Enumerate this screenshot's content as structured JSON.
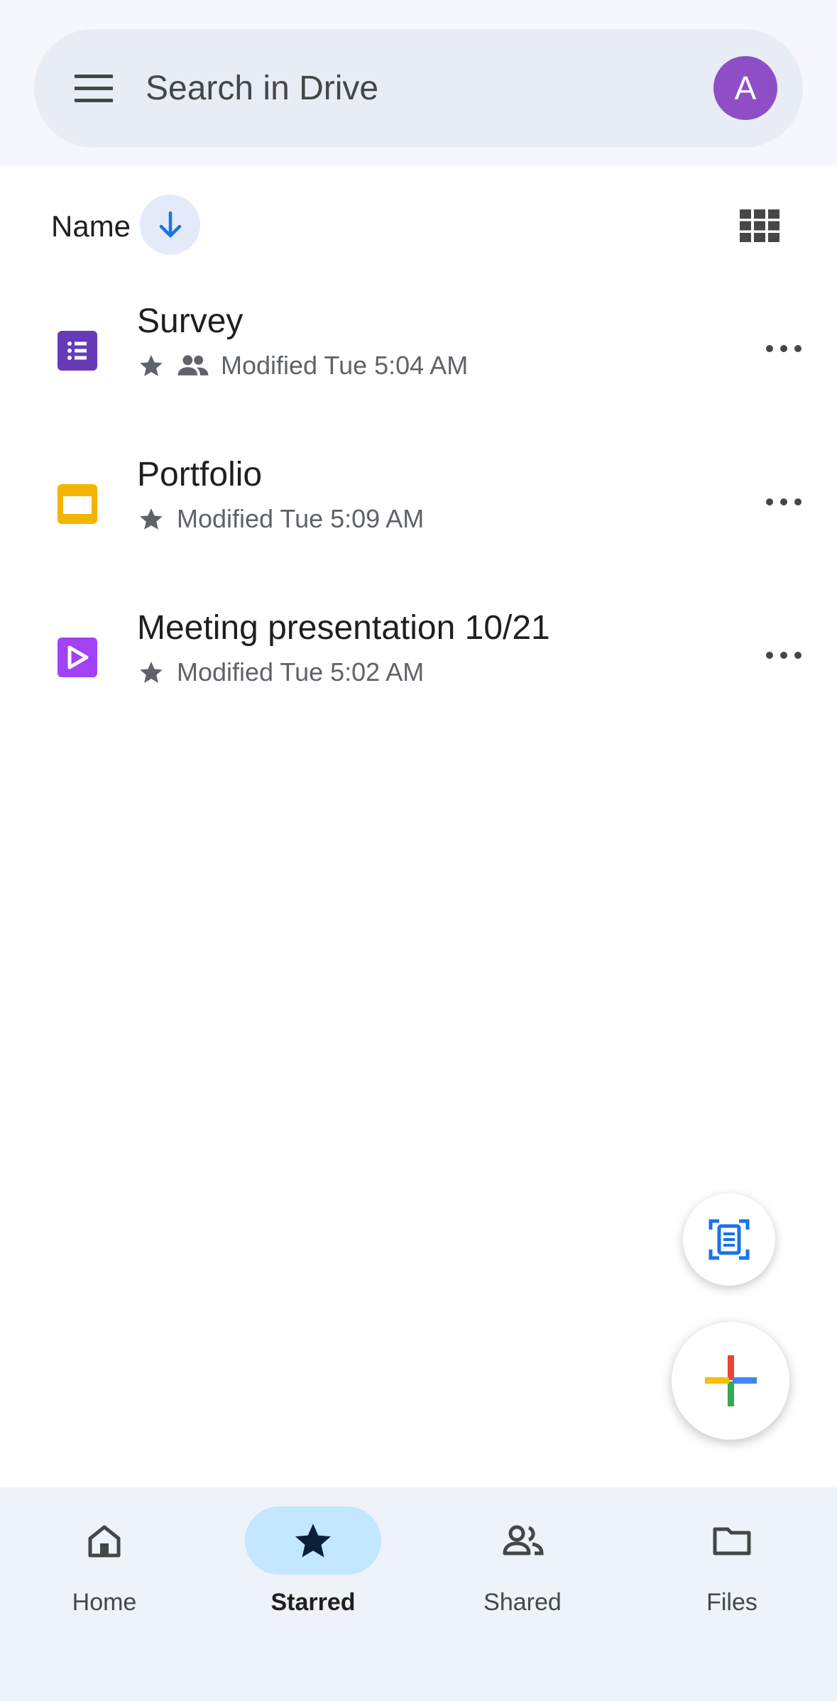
{
  "search": {
    "placeholder": "Search in Drive",
    "avatar_letter": "A",
    "avatar_color": "#8e4ec6"
  },
  "sort": {
    "label": "Name",
    "direction": "descending"
  },
  "files": [
    {
      "name": "Survey",
      "type": "forms",
      "icon": "forms-icon",
      "icon_color": "#673ab7",
      "starred": true,
      "shared": true,
      "modified": "Modified Tue 5:04 AM"
    },
    {
      "name": "Portfolio",
      "type": "slides",
      "icon": "slides-icon",
      "icon_color": "#f4b400",
      "starred": true,
      "shared": false,
      "modified": "Modified Tue 5:09 AM"
    },
    {
      "name": "Meeting presentation 10/21",
      "type": "vids",
      "icon": "vids-icon",
      "icon_color": "#a142f4",
      "starred": true,
      "shared": false,
      "modified": "Modified Tue 5:02 AM"
    }
  ],
  "fabs": {
    "scan_icon": "scan-document-icon",
    "new_icon": "plus-icon"
  },
  "nav": {
    "items": [
      {
        "label": "Home",
        "icon": "home-icon",
        "active": false
      },
      {
        "label": "Starred",
        "icon": "star-icon",
        "active": true
      },
      {
        "label": "Shared",
        "icon": "people-icon",
        "active": false
      },
      {
        "label": "Files",
        "icon": "folder-icon",
        "active": false
      }
    ]
  }
}
